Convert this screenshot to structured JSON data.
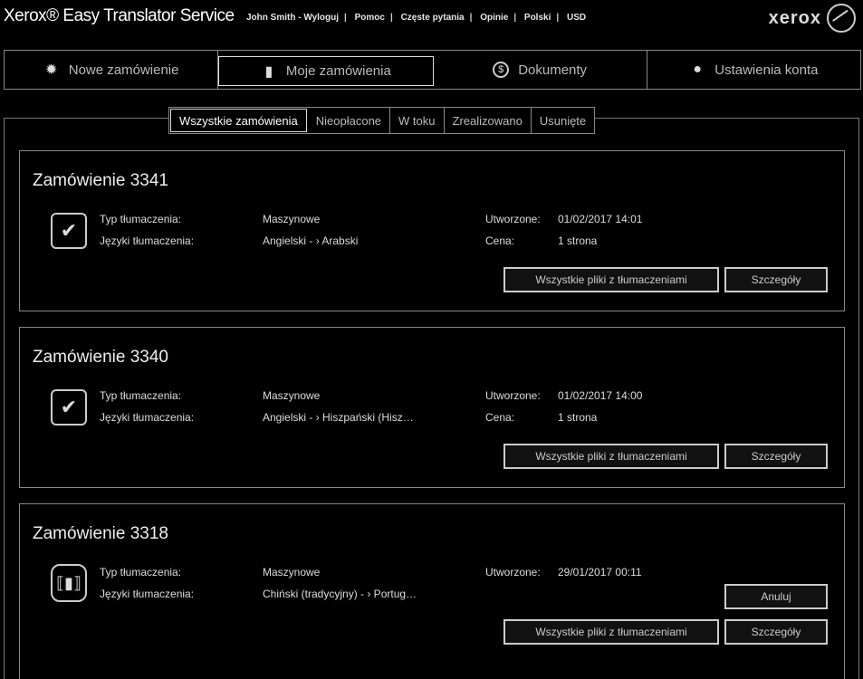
{
  "header": {
    "app_title": "Xerox® Easy Translator Service",
    "user_link": "John Smith - Wyloguj",
    "links": [
      "Pomoc",
      "Częste pytania",
      "Opinie",
      "Polski",
      "USD"
    ],
    "logo_text": "xerox"
  },
  "nav": {
    "tabs": [
      {
        "label": "Nowe zamówienie",
        "icon": "gear-icon"
      },
      {
        "label": "Moje zamówienia",
        "icon": "cart-icon"
      },
      {
        "label": "Dokumenty",
        "icon": "dollar-icon"
      },
      {
        "label": "Ustawienia konta",
        "icon": "user-icon"
      }
    ]
  },
  "filters": [
    "Wszystkie zamówienia",
    "Nieopłacone",
    "W toku",
    "Zrealizowano",
    "Usunięte"
  ],
  "labels": {
    "type": "Typ tłumaczenia:",
    "languages": "Języki tłumaczenia:",
    "created": "Utworzone:",
    "price": "Cena:",
    "download_all": "Wszystkie pliki z tłumaczeniami",
    "details": "Szczegóły",
    "cancel": "Anuluj"
  },
  "orders": [
    {
      "title": "Zamówienie 3341",
      "type": "Maszynowe",
      "languages": "Angielski - › Arabski",
      "created": "01/02/2017 14:01",
      "price": "1 strona"
    },
    {
      "title": "Zamówienie 3340",
      "type": "Maszynowe",
      "languages": "Angielski - › Hiszpański (Hisz…",
      "created": "01/02/2017 14:00",
      "price": "1 strona"
    },
    {
      "title": "Zamówienie 3318",
      "type": "Maszynowe",
      "languages": "Chiński (tradycyjny) - › Portug…",
      "created": "29/01/2017 00:11",
      "price": ""
    }
  ]
}
